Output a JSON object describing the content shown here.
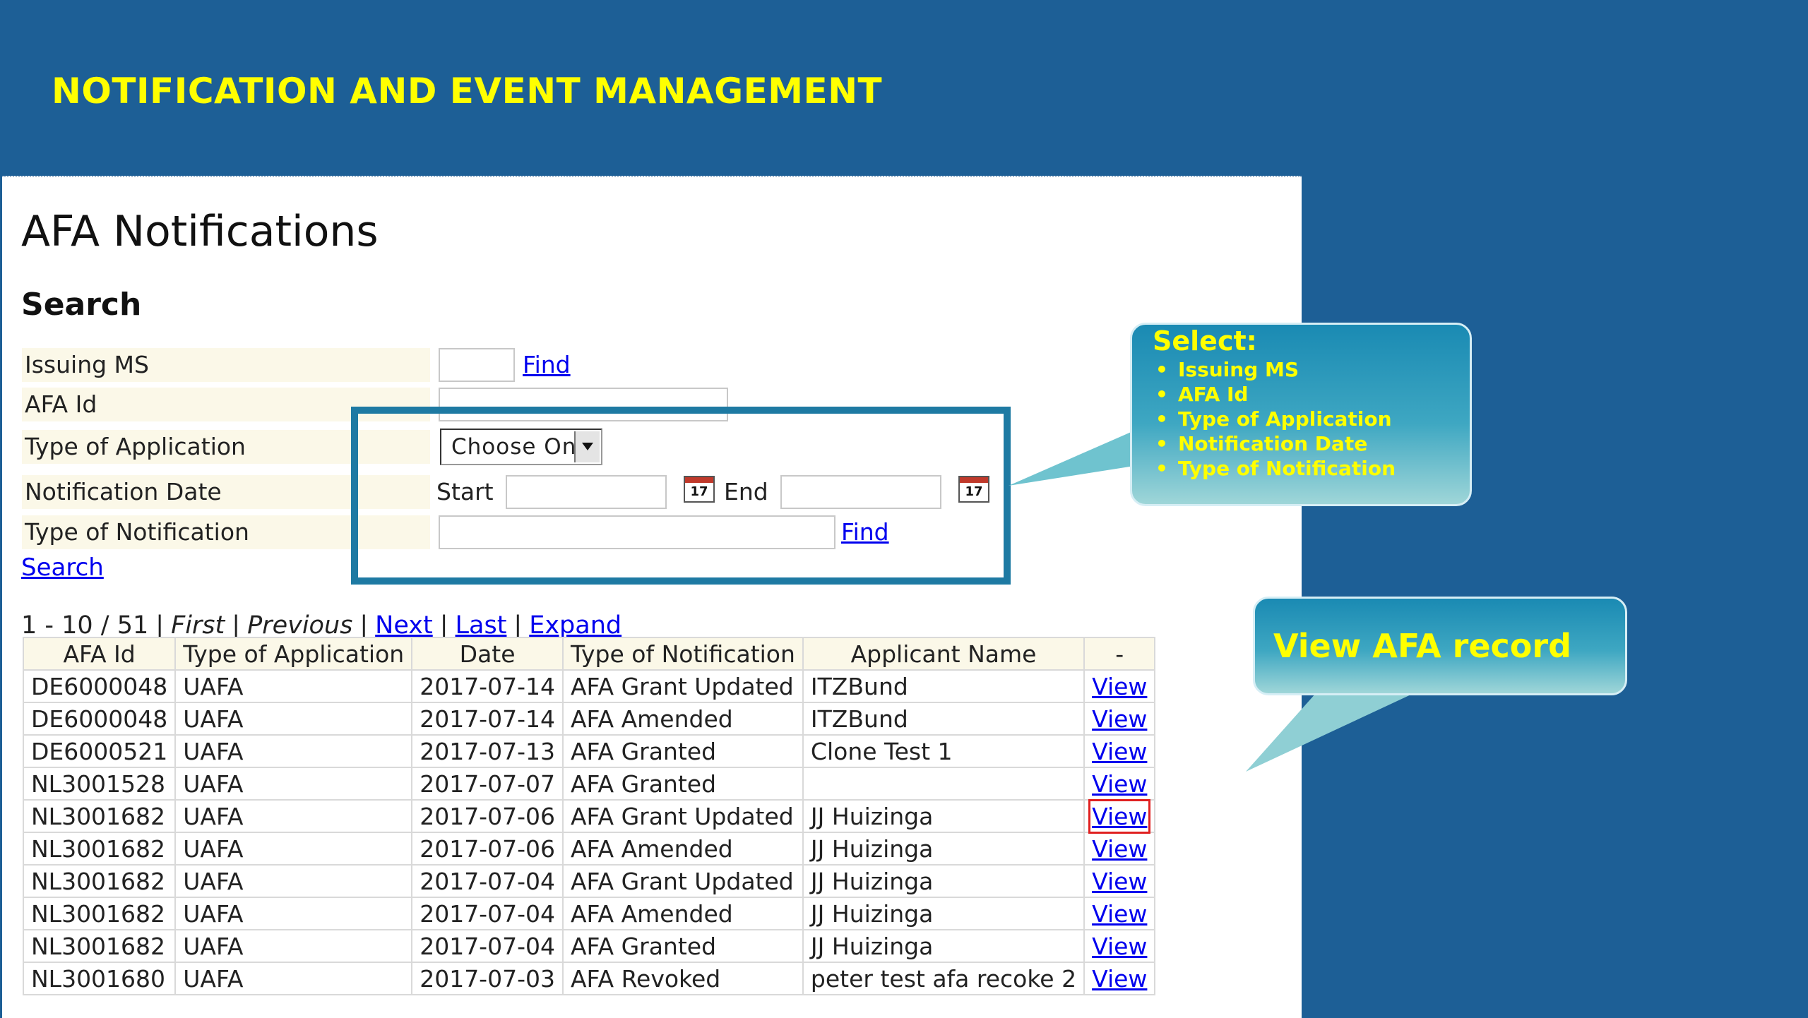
{
  "slide": {
    "title": "NOTIFICATION AND EVENT MANAGEMENT"
  },
  "page": {
    "title": "AFA Notifications",
    "section": "Search"
  },
  "form": {
    "issuing_ms": {
      "label": "Issuing MS",
      "value": "",
      "find": "Find"
    },
    "afa_id": {
      "label": "AFA Id",
      "value": ""
    },
    "type_of_application": {
      "label": "Type of Application",
      "selected": "Choose One"
    },
    "notification_date": {
      "label": "Notification Date",
      "start_label": "Start",
      "end_label": "End",
      "start_value": "",
      "end_value": "",
      "calendar_day": "17"
    },
    "type_of_notification": {
      "label": "Type of Notification",
      "value": "",
      "find": "Find"
    },
    "search_link": "Search"
  },
  "pager": {
    "range": "1 - 10 / 51",
    "first": "First",
    "previous": "Previous",
    "next": "Next",
    "last": "Last",
    "expand": "Expand",
    "separator": "|"
  },
  "table": {
    "headers": [
      "AFA Id",
      "Type of Application",
      "Date",
      "Type of Notification",
      "Applicant Name",
      "-"
    ],
    "rows": [
      [
        "DE6000048",
        "UAFA",
        "2017-07-14",
        "AFA Grant Updated",
        "ITZBund",
        "View"
      ],
      [
        "DE6000048",
        "UAFA",
        "2017-07-14",
        "AFA Amended",
        "ITZBund",
        "View"
      ],
      [
        "DE6000521",
        "UAFA",
        "2017-07-13",
        "AFA Granted",
        "Clone Test 1",
        "View"
      ],
      [
        "NL3001528",
        "UAFA",
        "2017-07-07",
        "AFA Granted",
        "",
        "View"
      ],
      [
        "NL3001682",
        "UAFA",
        "2017-07-06",
        "AFA Grant Updated",
        "JJ Huizinga",
        "View"
      ],
      [
        "NL3001682",
        "UAFA",
        "2017-07-06",
        "AFA Amended",
        "JJ Huizinga",
        "View"
      ],
      [
        "NL3001682",
        "UAFA",
        "2017-07-04",
        "AFA Grant Updated",
        "JJ Huizinga",
        "View"
      ],
      [
        "NL3001682",
        "UAFA",
        "2017-07-04",
        "AFA Amended",
        "JJ Huizinga",
        "View"
      ],
      [
        "NL3001682",
        "UAFA",
        "2017-07-04",
        "AFA Granted",
        "JJ Huizinga",
        "View"
      ],
      [
        "NL3001680",
        "UAFA",
        "2017-07-03",
        "AFA Revoked",
        "peter test afa recoke 2",
        "View"
      ]
    ],
    "highlighted_row": 4
  },
  "callouts": {
    "select": {
      "heading": "Select:",
      "items": [
        "Issuing MS",
        "AFA Id",
        "Type of Application",
        "Notification Date",
        "Type of Notification"
      ]
    },
    "view": {
      "heading": "View AFA record"
    }
  },
  "colors": {
    "slide_background": "#1d5f96",
    "title_yellow": "#ffff00",
    "highlight_border": "#1e7aa3",
    "link_blue": "#0000ee",
    "row_marker_red": "#e02020"
  }
}
